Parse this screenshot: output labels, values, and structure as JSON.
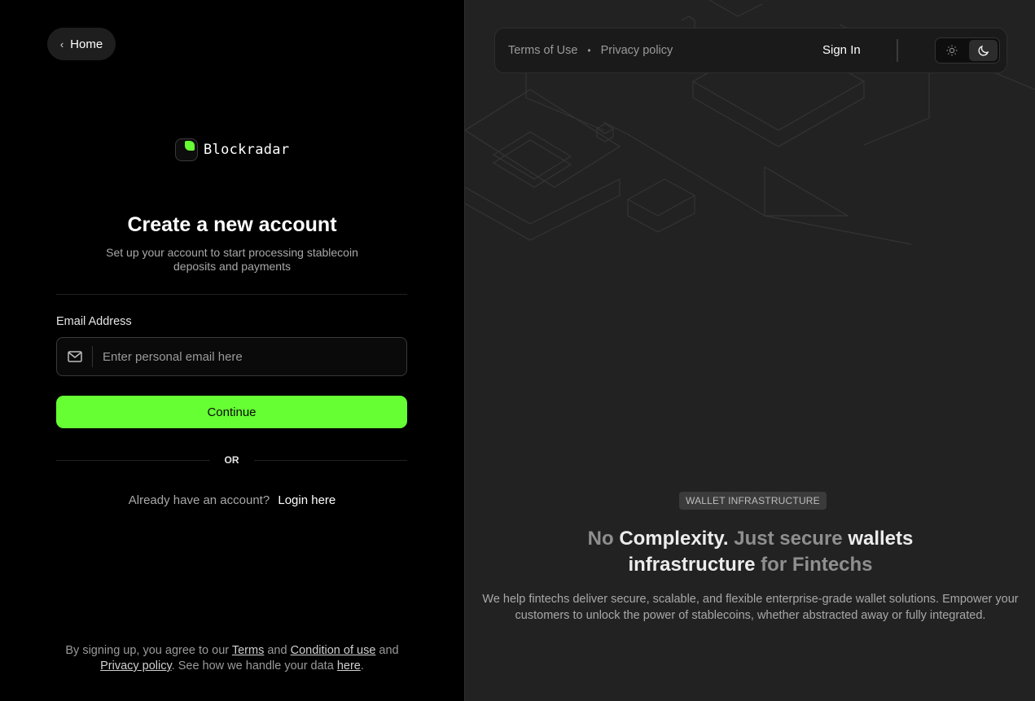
{
  "nav": {
    "home_label": "Home"
  },
  "brand": {
    "name": "Blockradar",
    "accent": "#66ff33"
  },
  "form": {
    "title": "Create a new account",
    "subtitle": "Set up your account to start processing stablecoin deposits and payments",
    "email_label": "Email Address",
    "email_placeholder": "Enter personal email here",
    "email_value": "",
    "continue_label": "Continue",
    "or_label": "OR",
    "login_prompt": "Already have an account?",
    "login_link": "Login here"
  },
  "footer": {
    "t1": "By signing up, you agree to our ",
    "terms": "Terms",
    "t2": " and ",
    "condition": "Condition of use",
    "t3": " and ",
    "privacy": "Privacy policy",
    "t4": ". See how we handle your data ",
    "here": "here",
    "t5": "."
  },
  "topbar": {
    "terms": "Terms of Use",
    "privacy": "Privacy policy",
    "sign_in": "Sign In",
    "theme_selected": "dark"
  },
  "hero": {
    "badge": "WALLET INFRASTRUCTURE",
    "h_no": "No ",
    "h_complexity": "Complexity.",
    "h_just_secure": " Just secure ",
    "h_wallets": "wallets",
    "h_infrastructure": "infrastructure",
    "h_for_fintechs": " for Fintechs",
    "description": "We help fintechs deliver secure, scalable, and flexible enterprise-grade wallet solutions. Empower your customers to unlock the power of stablecoins, whether abstracted away or fully integrated."
  }
}
